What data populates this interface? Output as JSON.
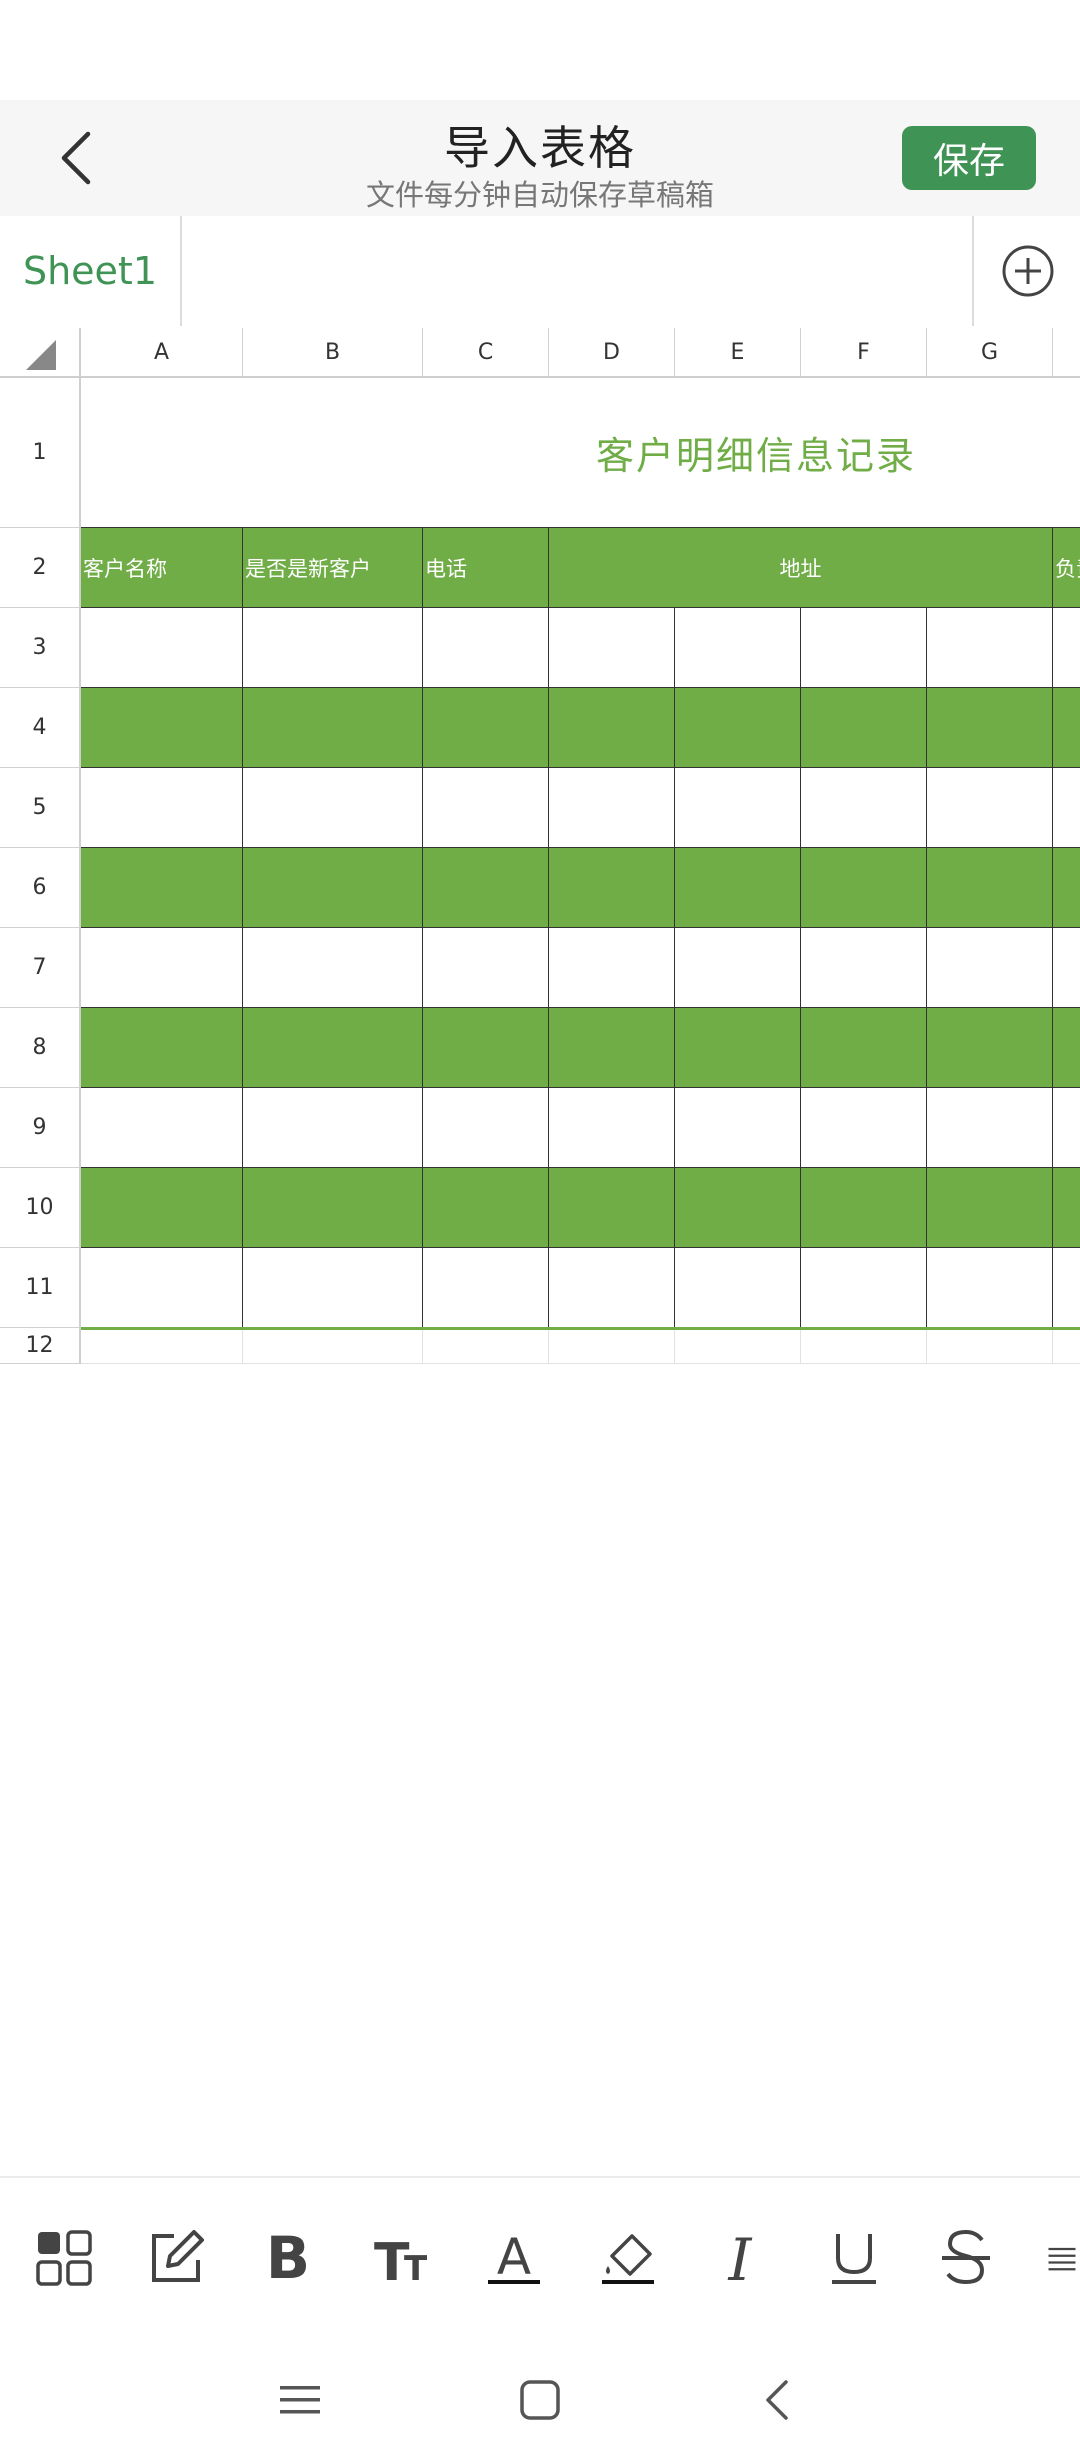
{
  "header": {
    "title": "导入表格",
    "subtitle": "文件每分钟自动保存草稿箱",
    "save_label": "保存"
  },
  "sheets": {
    "tabs": [
      "Sheet1"
    ],
    "active": "Sheet1"
  },
  "grid": {
    "columns": [
      "A",
      "B",
      "C",
      "D",
      "E",
      "F",
      "G"
    ],
    "rows": [
      "1",
      "2",
      "3",
      "4",
      "5",
      "6",
      "7",
      "8",
      "9",
      "10",
      "11",
      "12"
    ],
    "sheet_title": "客户明细信息记录",
    "header_row": {
      "a": "客户名称",
      "b": "是否是新客户",
      "c": "电话",
      "address": "地址",
      "h_partial": "负责"
    }
  },
  "toolbar": {
    "tools": [
      "grid-icon",
      "edit-icon",
      "bold-icon",
      "text-size-icon",
      "font-color-icon",
      "fill-color-icon",
      "italic-icon",
      "underline-icon",
      "strikethrough-icon",
      "align-icon"
    ]
  },
  "colors": {
    "accent": "#3f9354",
    "table_green": "#70ad47",
    "title_green": "#70ad47"
  }
}
